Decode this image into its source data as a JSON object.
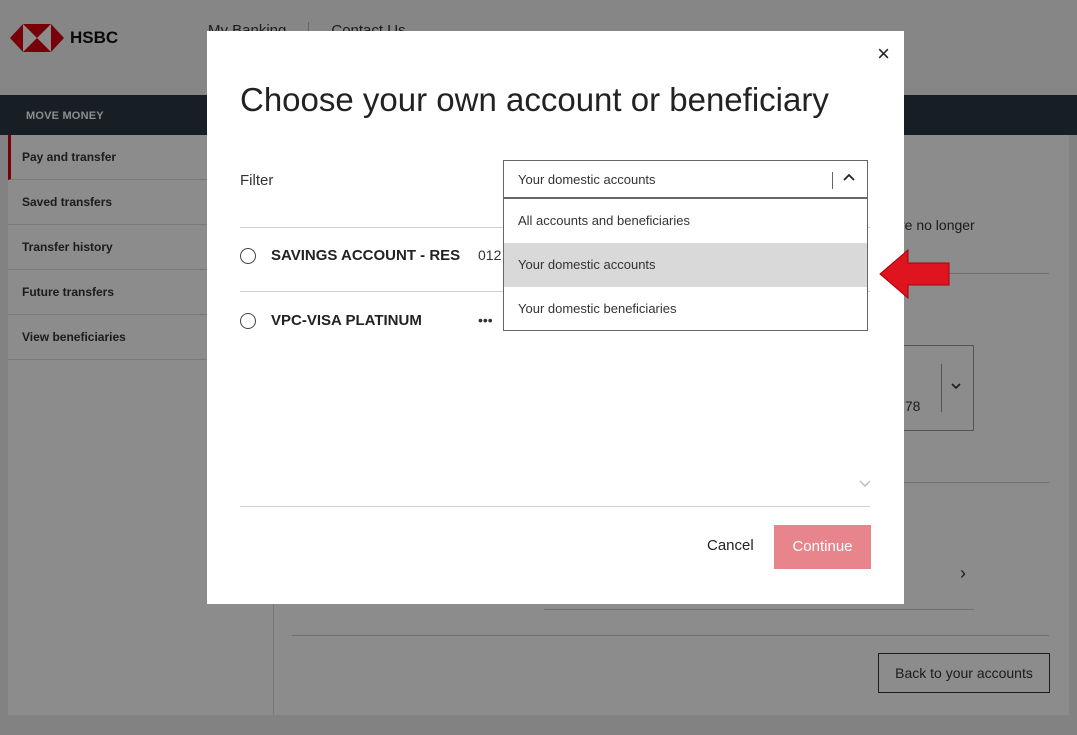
{
  "header": {
    "brand": "HSBC",
    "nav": [
      "My Banking",
      "Contact Us"
    ]
  },
  "sidebar": {
    "title": "MOVE MONEY",
    "items": [
      {
        "label": "Pay and transfer",
        "active": true
      },
      {
        "label": "Saved transfers"
      },
      {
        "label": "Transfer history"
      },
      {
        "label": "Future transfers"
      },
      {
        "label": "View beneficiaries"
      }
    ]
  },
  "background": {
    "text_partial": "re no longer",
    "amount_partial": ".78",
    "chevron_right": "›",
    "back_button": "Back to your accounts"
  },
  "modal": {
    "close": "×",
    "title": "Choose your own account or beneficiary",
    "filter_label": "Filter",
    "filter_value": "Your domestic accounts",
    "options": [
      {
        "label": "All accounts and beneficiaries"
      },
      {
        "label": "Your domestic accounts",
        "selected": true
      },
      {
        "label": "Your domestic beneficiaries"
      }
    ],
    "accounts": [
      {
        "name": "SAVINGS ACCOUNT - RES",
        "number": "012"
      },
      {
        "name": "VPC-VISA PLATINUM",
        "number": "•••"
      }
    ],
    "cancel": "Cancel",
    "continue": "Continue"
  },
  "colors": {
    "brand_red": "#db0011",
    "nav_dark": "#2b3944",
    "continue_disabled": "#e8858c",
    "annotation_arrow": "#e0141e"
  },
  "icons": [
    "hsbc-logo",
    "close-icon",
    "chevron-up-icon",
    "chevron-down-icon",
    "chevron-right-icon",
    "red-arrow-icon"
  ]
}
